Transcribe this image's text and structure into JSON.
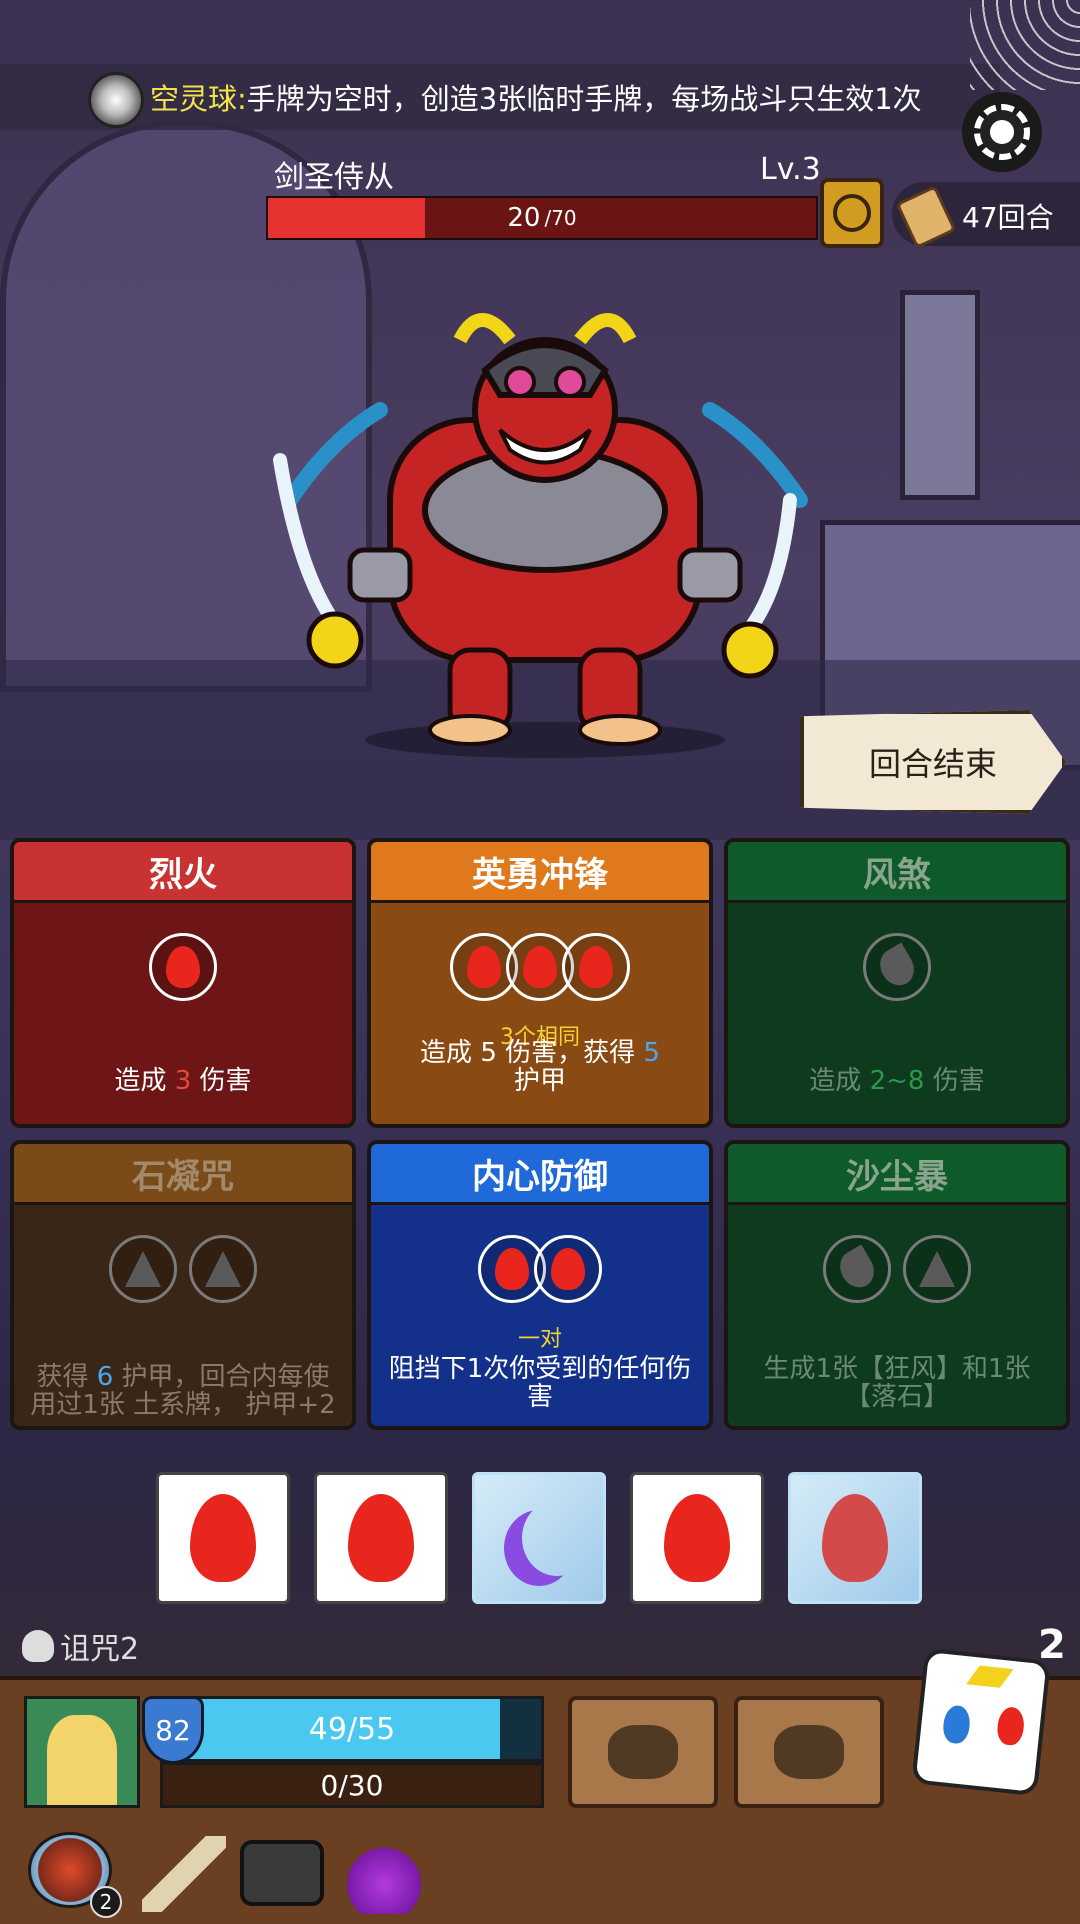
{
  "banner": {
    "name": "空灵球:",
    "text": "手牌为空时，创造3张临时手牌，每场战斗只生效1次"
  },
  "enemy": {
    "name": "剑圣侍从",
    "level": "Lv.3",
    "hp_current": "20",
    "hp_max": "/70",
    "hp_fraction": 0.2857
  },
  "turn": {
    "label": "47回合"
  },
  "end_turn": {
    "label": "回合结束"
  },
  "cards": [
    {
      "title": "烈火",
      "sub": "",
      "desc_pre": "造成 ",
      "desc_val": "3",
      "desc_post": " 伤害"
    },
    {
      "title": "英勇冲锋",
      "sub": "3个相同",
      "desc_pre": "造成 ",
      "desc_val": "5",
      "desc_mid": " 伤害，获得 ",
      "desc_val2": "5",
      "desc_post": "护甲"
    },
    {
      "title": "风煞",
      "sub": "",
      "desc_pre": "造成 ",
      "desc_val": "2~8",
      "desc_post": " 伤害"
    },
    {
      "title": "石凝咒",
      "sub": "",
      "desc_pre": "获得 ",
      "desc_val": "6",
      "desc_post": " 护甲，回合内每使用过1张 土系牌， 护甲+2"
    },
    {
      "title": "内心防御",
      "sub": "一对",
      "desc_pre": "阻挡下1次你受到的任何伤害"
    },
    {
      "title": "沙尘暴",
      "sub": "",
      "desc_pre": "生成1张【狂风】和1张【落石】"
    }
  ],
  "dice": [
    {
      "face": "fire",
      "frozen": false
    },
    {
      "face": "fire",
      "frozen": false
    },
    {
      "face": "moon",
      "frozen": true
    },
    {
      "face": "fire",
      "frozen": false
    },
    {
      "face": "fire",
      "frozen": true
    }
  ],
  "curse": {
    "label": "诅咒2"
  },
  "dice_remaining": "2",
  "player": {
    "armor": "82",
    "hp_text": "49/55",
    "hp_fraction": 0.8909,
    "energy_text": "0/30"
  },
  "relics": [
    {
      "icon": "bomb-plate-icon",
      "badge": "2"
    },
    {
      "icon": "horn-icon"
    },
    {
      "icon": "cauldron-icon"
    },
    {
      "icon": "potion-icon"
    }
  ],
  "colors": {
    "hp_red": "#e6332f",
    "hp_blue": "#4ac8f0",
    "accent_yellow": "#f3e44b"
  }
}
